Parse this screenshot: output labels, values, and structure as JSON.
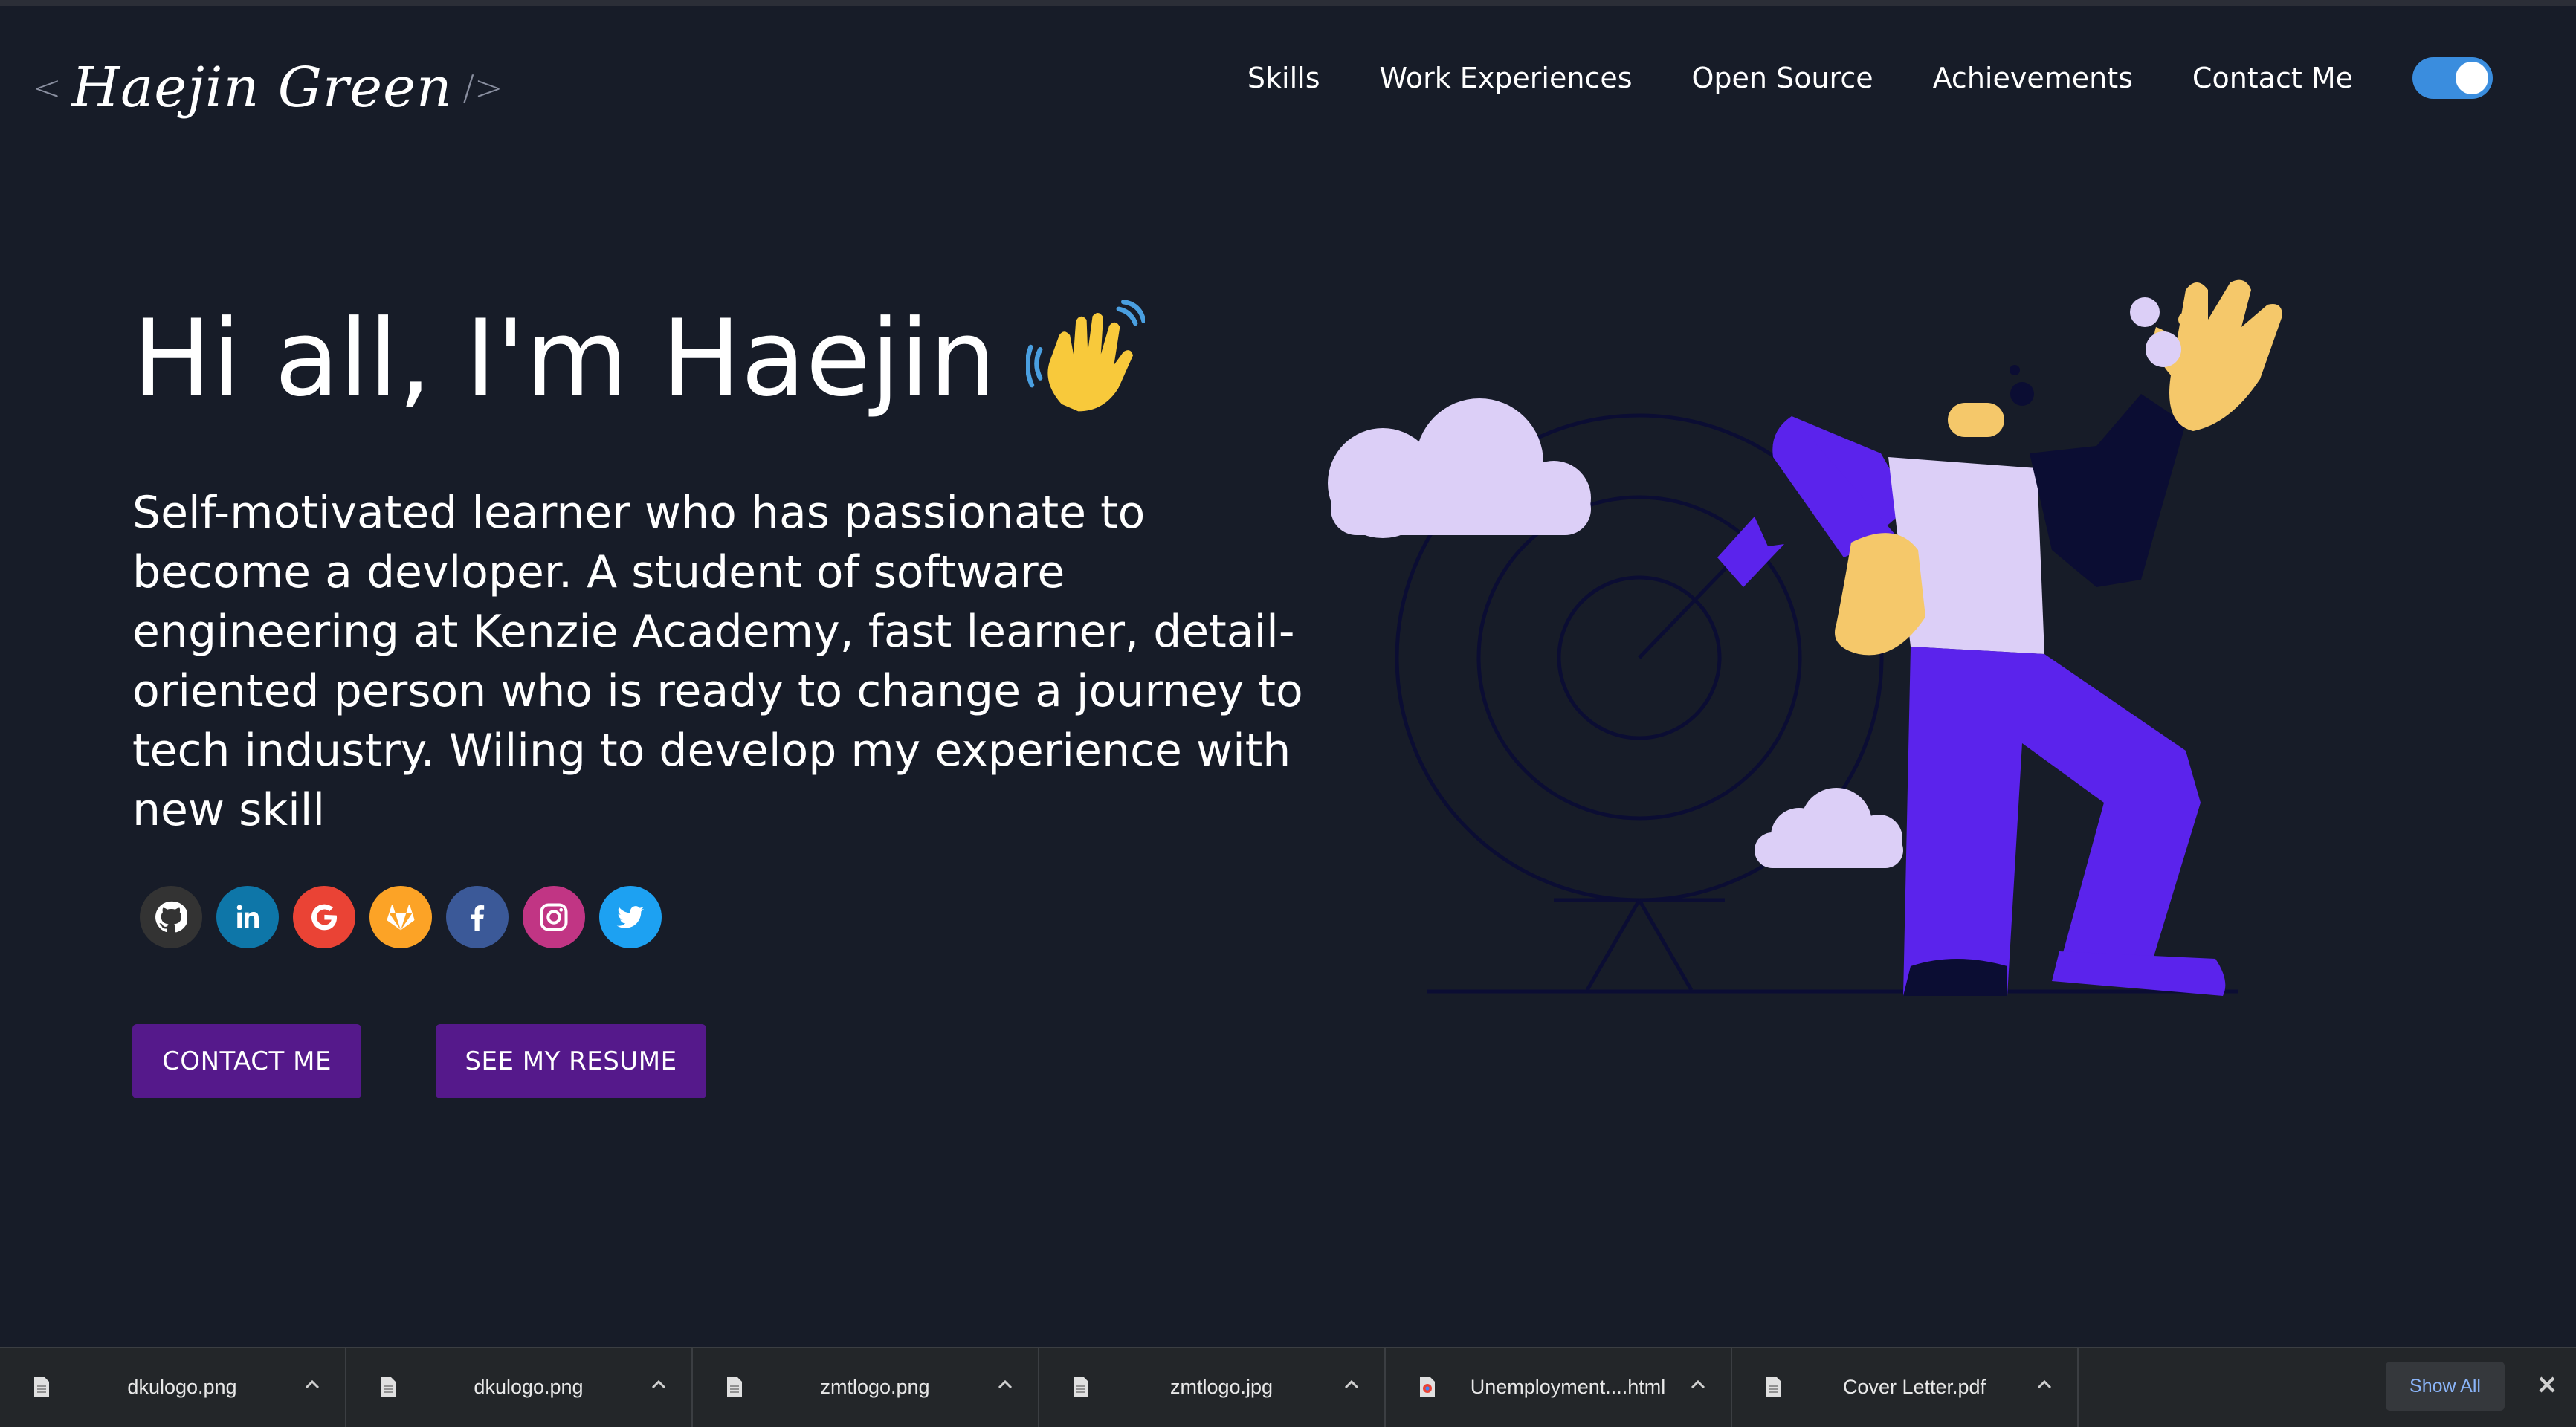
{
  "header": {
    "logo_open": "<",
    "logo_name": "Haejin Green",
    "logo_close": "/>",
    "nav": [
      "Skills",
      "Work Experiences",
      "Open Source",
      "Achievements",
      "Contact Me"
    ],
    "theme_toggle_on": true
  },
  "hero": {
    "greeting": "Hi all, I'm Haejin",
    "bio": "Self-motivated learner who has passionate to become a devloper. A student of software engineering at Kenzie Academy, fast learner, detail-oriented person who is ready to change a journey to tech industry. Wiling to develop my experience with new skill",
    "socials": [
      {
        "name": "github",
        "color": "#333333"
      },
      {
        "name": "linkedin",
        "color": "#0e76a8"
      },
      {
        "name": "google",
        "color": "#ea4335"
      },
      {
        "name": "gitlab",
        "color": "#fca326"
      },
      {
        "name": "facebook",
        "color": "#3b5998"
      },
      {
        "name": "instagram",
        "color": "#c13584"
      },
      {
        "name": "twitter",
        "color": "#1da1f2"
      }
    ],
    "contact_button": "CONTACT ME",
    "resume_button": "SEE MY RESUME"
  },
  "downloads": {
    "items": [
      "dkulogo.png",
      "dkulogo.png",
      "zmtlogo.png",
      "zmtlogo.jpg",
      "Unemployment....html",
      "Cover Letter.pdf"
    ],
    "show_all": "Show All"
  },
  "colors": {
    "background": "#171c28",
    "button": "#55198b",
    "toggle": "#3a8dde",
    "illustration_purple": "#5b23ec",
    "illustration_lavender": "#dccff7",
    "illustration_skin": "#f5c86a"
  }
}
